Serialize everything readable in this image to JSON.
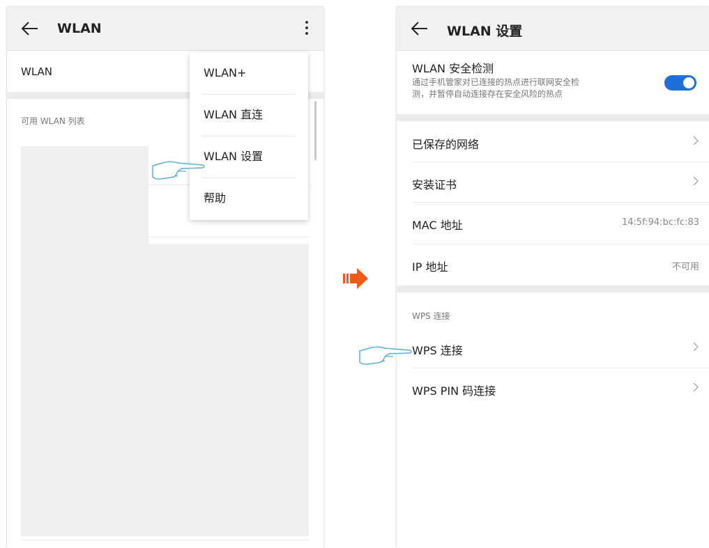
{
  "left_screen": {
    "title": "WLAN",
    "wlan_toggle_label": "WLAN",
    "available_list_header": "可用 WLAN 列表",
    "menu": {
      "items": [
        {
          "label": "WLAN+"
        },
        {
          "label": "WLAN 直连"
        },
        {
          "label": "WLAN 设置"
        },
        {
          "label": "帮助"
        }
      ]
    }
  },
  "right_screen": {
    "title": "WLAN 设置",
    "security_check": {
      "label": "WLAN 安全检测",
      "description_line1": "通过手机管家对已连接的热点进行联网安全检",
      "description_line2": "测，并暂停自动连接存在安全风险的热点",
      "enabled": true
    },
    "rows": {
      "saved_networks": "已保存的网络",
      "install_cert": "安装证书",
      "mac_label": "MAC 地址",
      "mac_value": "14:5f:94:bc:fc:83",
      "ip_label": "IP 地址",
      "ip_value": "不可用"
    },
    "wps_section_header": "WPS 连接",
    "wps_connect": "WPS 连接",
    "wps_pin_connect": "WPS PIN 码连接"
  },
  "colors": {
    "toggle_on": "#1f6fd8",
    "flow_arrow": "#f05a1a",
    "hand_outline": "#5ab0d8"
  },
  "icons": [
    "back-arrow-icon",
    "more-vert-icon",
    "chevron-right-icon",
    "pointing-hand-icon",
    "flow-arrow-icon"
  ]
}
